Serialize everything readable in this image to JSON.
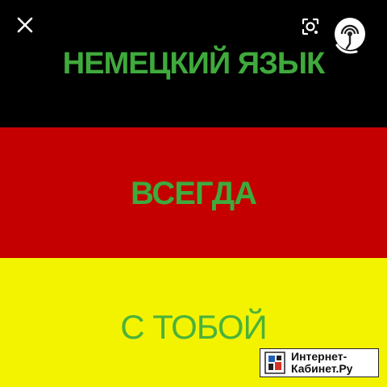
{
  "banner": {
    "line1": "НЕМЕЦКИЙ ЯЗЫК",
    "line2": "ВСЕГДА",
    "line3": "С ТОБОЙ"
  },
  "colors": {
    "stripe_black": "#000000",
    "stripe_red": "#c40000",
    "stripe_yellow": "#f3f300",
    "text_green": "#3faa3c"
  },
  "toolbar": {
    "close_icon": "close-icon",
    "lens_icon": "lens-search-icon"
  },
  "podcast_logo_icon": "podcast-speaker-icon",
  "watermark": {
    "line1": "Интернет-",
    "line2": "Кабинет.Ру"
  }
}
